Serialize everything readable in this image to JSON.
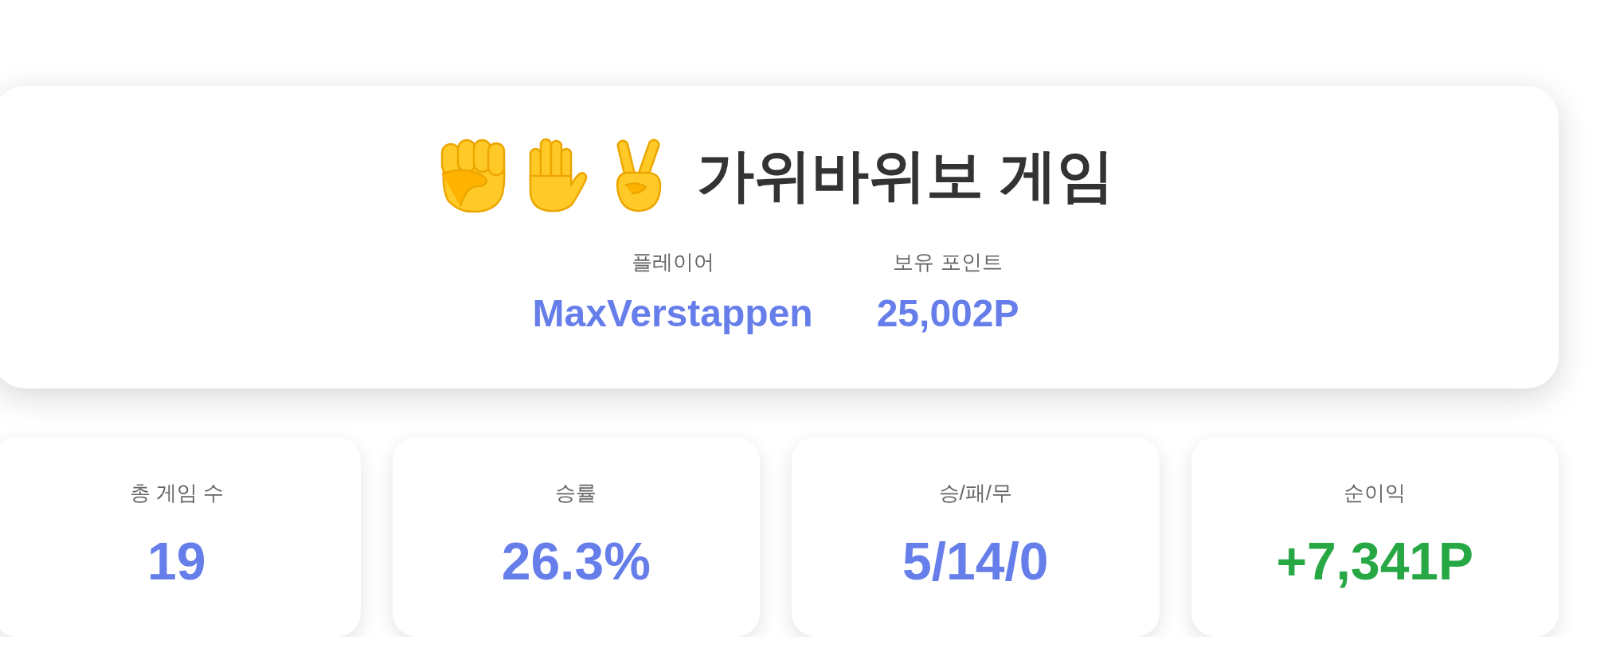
{
  "header": {
    "title": "가위바위보 게임",
    "info": [
      {
        "label": "플레이어",
        "value": "MaxVerstappen"
      },
      {
        "label": "보유 포인트",
        "value": "25,002P"
      }
    ]
  },
  "stats": [
    {
      "label": "총 게임 수",
      "value": "19",
      "color": "#667eea"
    },
    {
      "label": "승률",
      "value": "26.3%",
      "color": "#667eea"
    },
    {
      "label": "승/패/무",
      "value": "5/14/0",
      "color": "#667eea"
    },
    {
      "label": "순이익",
      "value": "+7,341P",
      "color": "#28a745"
    }
  ]
}
